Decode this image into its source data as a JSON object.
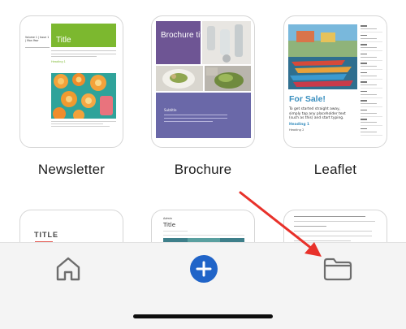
{
  "templates": [
    {
      "label": "Newsletter",
      "side_title": "Volume 1 | Issue 1 | Mon Year",
      "title": "Title",
      "heading": "Heading 1"
    },
    {
      "label": "Brochure",
      "title": "Brochure title",
      "subtitle": "Subtitle"
    },
    {
      "label": "Leaflet",
      "title": "For Sale!",
      "body": "To get started straight away, simply tap any placeholder text (such as this) and start typing.",
      "heading": "Heading 1",
      "heading2": "Heading 2"
    },
    {
      "title": "TITLE"
    },
    {
      "small_title": "Admin",
      "title": "Title"
    },
    {}
  ],
  "tab_bar": {
    "items": [
      {
        "icon": "home-icon"
      },
      {
        "icon": "plus-icon"
      },
      {
        "icon": "folder-icon"
      }
    ]
  },
  "colors": {
    "accent_blue": "#2064c8",
    "annotation_red": "#e8312a",
    "newsletter_green": "#7cb82f",
    "brochure_purple": "#6e5594",
    "leaflet_blue": "#3a8fbf"
  }
}
